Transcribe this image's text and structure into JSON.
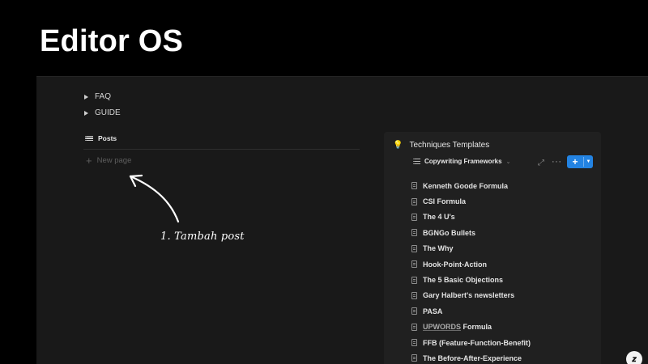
{
  "slide": {
    "title": "Editor OS"
  },
  "workspace": {
    "toggles": [
      {
        "label": "FAQ"
      },
      {
        "label": "GUIDE"
      }
    ],
    "posts": {
      "title": "Posts",
      "new_page_label": "New page"
    },
    "annotation": "1. Tambah post"
  },
  "panel": {
    "icon": "lightbulb-icon",
    "title": "Techniques Templates",
    "view_name": "Copywriting Frameworks",
    "new_button_label": "+",
    "items": [
      {
        "label": "Kenneth Goode Formula"
      },
      {
        "label": "CSI Formula"
      },
      {
        "label": "The 4 U's"
      },
      {
        "label": "BGNGo Bullets"
      },
      {
        "label": "The Why"
      },
      {
        "label": "Hook-Point-Action"
      },
      {
        "label": "The 5 Basic Objections"
      },
      {
        "label": "Gary Halbert's newsletters"
      },
      {
        "label": "PASA"
      },
      {
        "label_highlight": "UPWORDS",
        "label_rest": " Formula"
      },
      {
        "label": "FFB (Feature-Function-Benefit)"
      },
      {
        "label": "The Before-After-Experience"
      }
    ]
  },
  "colors": {
    "accent": "#2383e2",
    "background": "#191919",
    "panel": "#202020"
  }
}
